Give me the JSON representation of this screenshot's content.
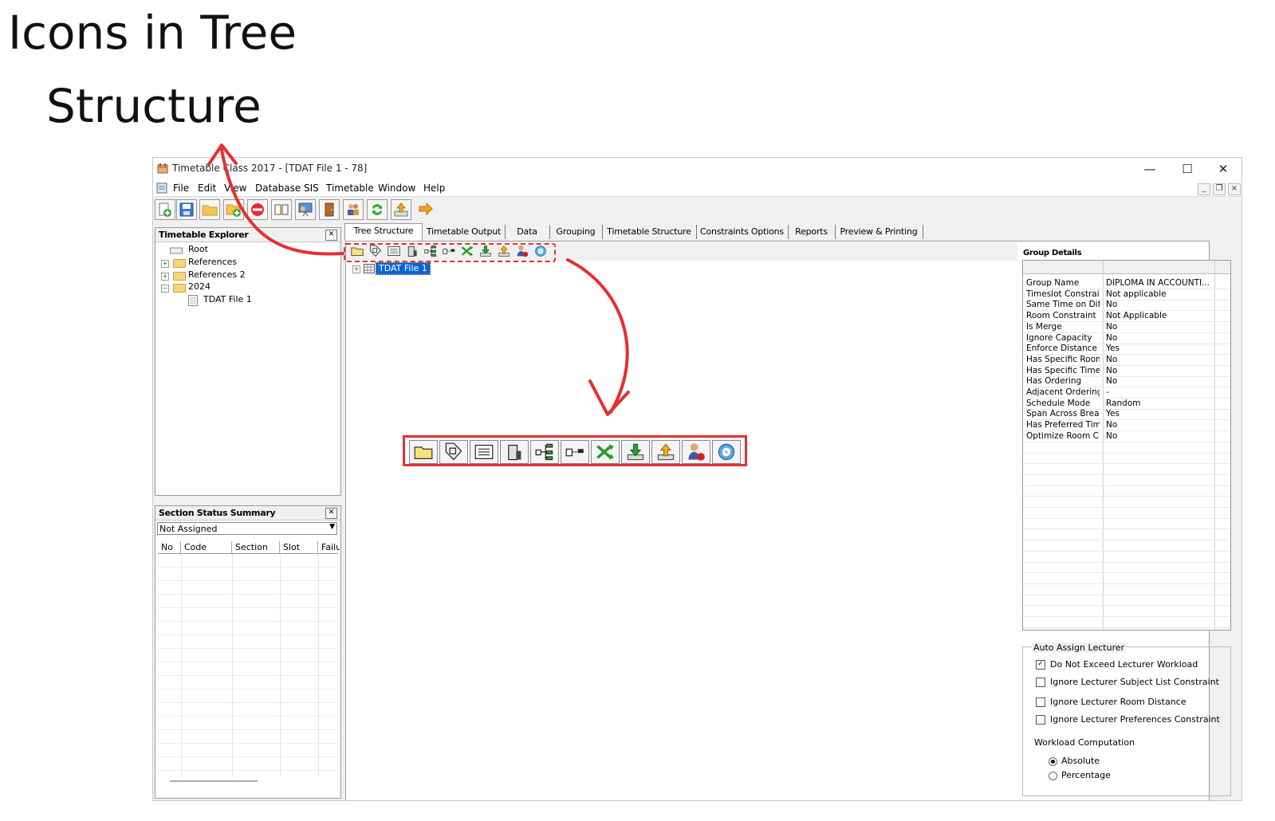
{
  "annotation": {
    "line1": "Icons in Tree",
    "line2": "Structure"
  },
  "window": {
    "title": "Timetable Class 2017 - [TDAT File 1 - 78]"
  },
  "menu": [
    "File",
    "Edit",
    "View",
    "Database",
    "SIS",
    "Timetable",
    "Window",
    "Help"
  ],
  "explorer": {
    "title": "Timetable Explorer",
    "items": [
      "Root",
      "References",
      "References 2",
      "2024",
      "TDAT File 1"
    ]
  },
  "section_status": {
    "title": "Section Status Summary",
    "filter": "Not Assigned",
    "columns": [
      "No",
      "Code",
      "Section",
      "Slot",
      "Failu"
    ]
  },
  "tabs": [
    "Tree Structure",
    "Timetable Output",
    "Data",
    "Grouping",
    "Timetable Structure",
    "Constraints Options",
    "Reports",
    "Preview & Printing"
  ],
  "tree": {
    "node": "TDAT File 1"
  },
  "tree_toolbar_icons": [
    "open-folder-icon",
    "tag-icon",
    "list-icon",
    "building-icon",
    "hierarchy-icon",
    "link-icon",
    "shuffle-icon",
    "download-icon",
    "upload-icon",
    "user-alert-icon",
    "refresh-icon"
  ],
  "group_details": {
    "title": "Group Details",
    "rows": [
      {
        "k": "Group Name",
        "v": "DIPLOMA IN ACCOUNTI..."
      },
      {
        "k": "Timeslot Constraint",
        "v": "Not applicable"
      },
      {
        "k": "Same Time on Dif...",
        "v": "No"
      },
      {
        "k": "Room Constraint",
        "v": "Not Applicable"
      },
      {
        "k": "Is Merge",
        "v": "No"
      },
      {
        "k": "Ignore Capacity",
        "v": "No"
      },
      {
        "k": "Enforce Distance",
        "v": "Yes"
      },
      {
        "k": "Has Specific Room",
        "v": "No"
      },
      {
        "k": "Has Specific Time",
        "v": "No"
      },
      {
        "k": "Has Ordering",
        "v": "No"
      },
      {
        "k": "Adjacent Ordering",
        "v": "-"
      },
      {
        "k": "Schedule Mode",
        "v": "Random"
      },
      {
        "k": "Span Across Break",
        "v": "Yes"
      },
      {
        "k": "Has Preferred Time",
        "v": "No"
      },
      {
        "k": "Optimize Room C...",
        "v": "No"
      }
    ]
  },
  "auto_assign": {
    "legend": "Auto Assign Lecturer",
    "options": [
      {
        "label": "Do Not Exceed Lecturer Workload",
        "checked": true
      },
      {
        "label": "Ignore Lecturer Subject List Constraint",
        "checked": false
      },
      {
        "label": "Ignore Lecturer Room Distance",
        "checked": false
      },
      {
        "label": "Ignore Lecturer Preferences Constraint",
        "checked": false
      }
    ],
    "workload_label": "Workload Computation",
    "workload_options": [
      {
        "label": "Absolute",
        "selected": true
      },
      {
        "label": "Percentage",
        "selected": false
      }
    ]
  },
  "colors": {
    "highlight": "#e63030",
    "selection": "#0a64d6"
  }
}
